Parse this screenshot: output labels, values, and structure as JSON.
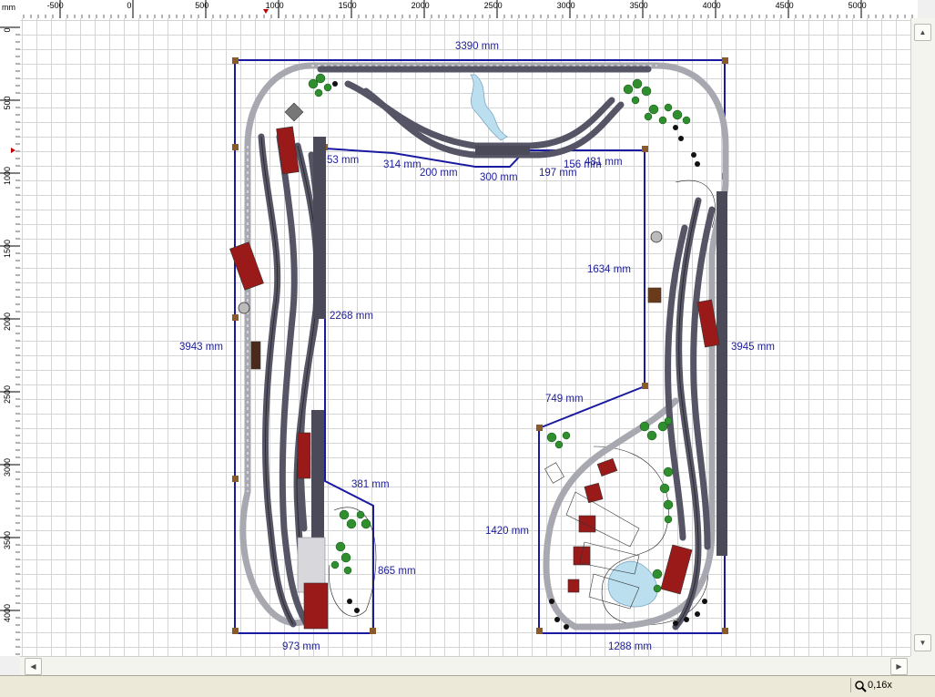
{
  "rulers": {
    "unit": "mm",
    "horizontal_ticks": [
      "-500",
      "0",
      "500",
      "1000",
      "1500",
      "2000",
      "2500",
      "3000",
      "3500",
      "4000",
      "4500",
      "5000"
    ],
    "vertical_ticks": [
      "0",
      "500",
      "1000",
      "1500",
      "2000",
      "2500",
      "3000",
      "3500",
      "4000"
    ]
  },
  "dimensions": {
    "top_width": "3390 mm",
    "seg_53": "53 mm",
    "seg_314": "314 mm",
    "seg_200": "200 mm",
    "seg_300": "300 mm",
    "seg_197": "197 mm",
    "seg_156": "156 mm",
    "seg_481": "481 mm",
    "inner_left_height": "2268 mm",
    "inner_right_height": "1634 mm",
    "left_height": "3943 mm",
    "right_height": "3945 mm",
    "diag_749": "749 mm",
    "diag_381": "381 mm",
    "right_865": "865 mm",
    "left_1420": "1420 mm",
    "bottom_left": "973 mm",
    "bottom_right": "1288 mm"
  },
  "status": {
    "zoom": "0,16x"
  },
  "colors": {
    "board_outline": "#1a1aa0",
    "track_dark": "#555566",
    "track_light": "#a8a8b0",
    "building_red": "#9a1a1a",
    "platform": "#4a4a58",
    "water": "#bcdff0",
    "tree": "#2f8f2f"
  },
  "icons": {
    "scroll_up": "triangle-up",
    "scroll_down": "triangle-down",
    "scroll_left": "triangle-left",
    "scroll_right": "triangle-right",
    "zoom": "magnifier"
  }
}
